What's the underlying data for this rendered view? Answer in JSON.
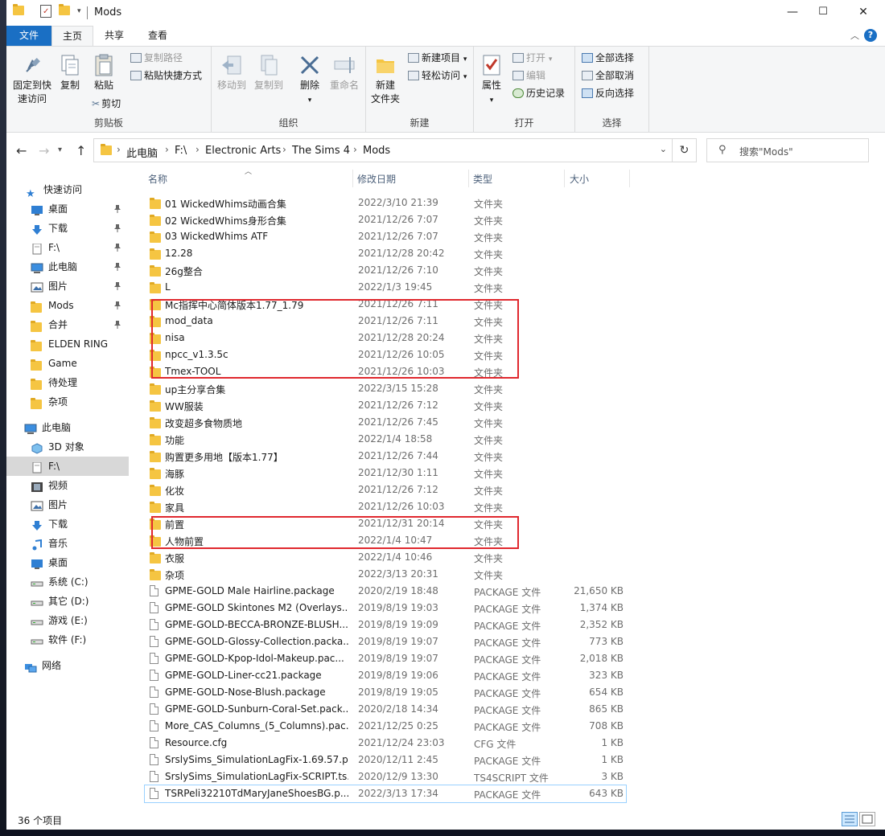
{
  "window": {
    "title": "Mods",
    "minimize": "—",
    "maximize": "☐",
    "close": "✕"
  },
  "tabs": {
    "file": "文件",
    "home": "主页",
    "share": "共享",
    "view": "查看"
  },
  "ribbon": {
    "clipboard": {
      "label": "剪贴板",
      "pin": "固定到快速访问",
      "pin_line1": "固定到快",
      "pin_line2": "速访问",
      "copy": "复制",
      "paste": "粘贴",
      "cut": "剪切",
      "copy_path": "复制路径",
      "paste_shortcut": "粘贴快捷方式"
    },
    "organize": {
      "label": "组织",
      "move_to": "移动到",
      "copy_to": "复制到",
      "delete": "删除",
      "rename": "重命名"
    },
    "new": {
      "label": "新建",
      "new_folder_line1": "新建",
      "new_folder_line2": "文件夹",
      "new_item": "新建项目",
      "easy_access": "轻松访问"
    },
    "open": {
      "label": "打开",
      "properties": "属性",
      "open": "打开",
      "edit": "编辑",
      "history": "历史记录"
    },
    "select": {
      "label": "选择",
      "select_all": "全部选择",
      "select_none": "全部取消",
      "invert": "反向选择"
    }
  },
  "address": {
    "crumbs": [
      "此电脑",
      "F:\\",
      "Electronic Arts",
      "The Sims 4",
      "Mods"
    ],
    "search_placeholder": "搜索\"Mods\""
  },
  "nav": {
    "quick_access": "快速访问",
    "quick_items": [
      {
        "label": "桌面",
        "icon": "desktop-icon",
        "pinned": true
      },
      {
        "label": "下载",
        "icon": "download-icon",
        "pinned": true
      },
      {
        "label": "F:\\",
        "icon": "drive-icon",
        "pinned": true
      },
      {
        "label": "此电脑",
        "icon": "computer-icon",
        "pinned": true
      },
      {
        "label": "图片",
        "icon": "pictures-icon",
        "pinned": true
      },
      {
        "label": "Mods",
        "icon": "folder-icon",
        "pinned": true
      },
      {
        "label": "合并",
        "icon": "folder-icon",
        "pinned": true
      },
      {
        "label": "ELDEN RING",
        "icon": "folder-icon",
        "pinned": false
      },
      {
        "label": "Game",
        "icon": "folder-icon",
        "pinned": false
      },
      {
        "label": "待处理",
        "icon": "folder-icon",
        "pinned": false
      },
      {
        "label": "杂项",
        "icon": "folder-icon",
        "pinned": false
      }
    ],
    "this_pc": "此电脑",
    "pc_items": [
      {
        "label": "3D 对象",
        "icon": "3d-objects-icon"
      },
      {
        "label": "F:\\",
        "icon": "drive-icon",
        "selected": true
      },
      {
        "label": "视频",
        "icon": "video-icon"
      },
      {
        "label": "图片",
        "icon": "pictures-icon"
      },
      {
        "label": "下载",
        "icon": "download-icon"
      },
      {
        "label": "音乐",
        "icon": "music-icon"
      },
      {
        "label": "桌面",
        "icon": "desktop-icon"
      },
      {
        "label": "系统 (C:)",
        "icon": "disk-icon"
      },
      {
        "label": "其它 (D:)",
        "icon": "disk-icon"
      },
      {
        "label": "游戏 (E:)",
        "icon": "disk-icon"
      },
      {
        "label": "软件 (F:)",
        "icon": "disk-icon"
      }
    ],
    "network": "网络"
  },
  "columns": {
    "name": "名称",
    "date": "修改日期",
    "type": "类型",
    "size": "大小"
  },
  "files": [
    {
      "name": "01 WickedWhims动画合集",
      "date": "2022/3/10 21:39",
      "type": "文件夹",
      "size": "",
      "kind": "folder"
    },
    {
      "name": "02 WickedWhims身形合集",
      "date": "2021/12/26 7:07",
      "type": "文件夹",
      "size": "",
      "kind": "folder"
    },
    {
      "name": "03 WickedWhims ATF",
      "date": "2021/12/26 7:07",
      "type": "文件夹",
      "size": "",
      "kind": "folder"
    },
    {
      "name": "12.28",
      "date": "2021/12/28 20:42",
      "type": "文件夹",
      "size": "",
      "kind": "folder"
    },
    {
      "name": "26g整合",
      "date": "2021/12/26 7:10",
      "type": "文件夹",
      "size": "",
      "kind": "folder"
    },
    {
      "name": "L",
      "date": "2022/1/3 19:45",
      "type": "文件夹",
      "size": "",
      "kind": "folder"
    },
    {
      "name": "Mc指挥中心简体版本1.77_1.79",
      "date": "2021/12/26 7:11",
      "type": "文件夹",
      "size": "",
      "kind": "folder"
    },
    {
      "name": "mod_data",
      "date": "2021/12/26 7:11",
      "type": "文件夹",
      "size": "",
      "kind": "folder"
    },
    {
      "name": "nisa",
      "date": "2021/12/28 20:24",
      "type": "文件夹",
      "size": "",
      "kind": "folder"
    },
    {
      "name": "npcc_v1.3.5c",
      "date": "2021/12/26 10:05",
      "type": "文件夹",
      "size": "",
      "kind": "folder"
    },
    {
      "name": "Tmex-TOOL",
      "date": "2021/12/26 10:03",
      "type": "文件夹",
      "size": "",
      "kind": "folder"
    },
    {
      "name": "up主分享合集",
      "date": "2022/3/15 15:28",
      "type": "文件夹",
      "size": "",
      "kind": "folder"
    },
    {
      "name": "WW服装",
      "date": "2021/12/26 7:12",
      "type": "文件夹",
      "size": "",
      "kind": "folder"
    },
    {
      "name": "改变超多食物质地",
      "date": "2021/12/26 7:45",
      "type": "文件夹",
      "size": "",
      "kind": "folder"
    },
    {
      "name": "功能",
      "date": "2022/1/4 18:58",
      "type": "文件夹",
      "size": "",
      "kind": "folder"
    },
    {
      "name": "购置更多用地【版本1.77】",
      "date": "2021/12/26 7:44",
      "type": "文件夹",
      "size": "",
      "kind": "folder"
    },
    {
      "name": "海豚",
      "date": "2021/12/30 1:11",
      "type": "文件夹",
      "size": "",
      "kind": "folder"
    },
    {
      "name": "化妆",
      "date": "2021/12/26 7:12",
      "type": "文件夹",
      "size": "",
      "kind": "folder"
    },
    {
      "name": "家具",
      "date": "2021/12/26 10:03",
      "type": "文件夹",
      "size": "",
      "kind": "folder"
    },
    {
      "name": "前置",
      "date": "2021/12/31 20:14",
      "type": "文件夹",
      "size": "",
      "kind": "folder"
    },
    {
      "name": "人物前置",
      "date": "2022/1/4 10:47",
      "type": "文件夹",
      "size": "",
      "kind": "folder"
    },
    {
      "name": "衣服",
      "date": "2022/1/4 10:46",
      "type": "文件夹",
      "size": "",
      "kind": "folder"
    },
    {
      "name": "杂项",
      "date": "2022/3/13 20:31",
      "type": "文件夹",
      "size": "",
      "kind": "folder"
    },
    {
      "name": "GPME-GOLD Male Hairline.package",
      "date": "2020/2/19 18:48",
      "type": "PACKAGE 文件",
      "size": "21,650 KB",
      "kind": "file"
    },
    {
      "name": "GPME-GOLD Skintones M2 (Overlays...",
      "date": "2019/8/19 19:03",
      "type": "PACKAGE 文件",
      "size": "1,374 KB",
      "kind": "file"
    },
    {
      "name": "GPME-GOLD-BECCA-BRONZE-BLUSH...",
      "date": "2019/8/19 19:09",
      "type": "PACKAGE 文件",
      "size": "2,352 KB",
      "kind": "file"
    },
    {
      "name": "GPME-GOLD-Glossy-Collection.packa...",
      "date": "2019/8/19 19:07",
      "type": "PACKAGE 文件",
      "size": "773 KB",
      "kind": "file"
    },
    {
      "name": "GPME-GOLD-Kpop-Idol-Makeup.pac...",
      "date": "2019/8/19 19:07",
      "type": "PACKAGE 文件",
      "size": "2,018 KB",
      "kind": "file"
    },
    {
      "name": "GPME-GOLD-Liner-cc21.package",
      "date": "2019/8/19 19:06",
      "type": "PACKAGE 文件",
      "size": "323 KB",
      "kind": "file"
    },
    {
      "name": "GPME-GOLD-Nose-Blush.package",
      "date": "2019/8/19 19:05",
      "type": "PACKAGE 文件",
      "size": "654 KB",
      "kind": "file"
    },
    {
      "name": "GPME-GOLD-Sunburn-Coral-Set.pack...",
      "date": "2020/2/18 14:34",
      "type": "PACKAGE 文件",
      "size": "865 KB",
      "kind": "file"
    },
    {
      "name": "More_CAS_Columns_(5_Columns).pac...",
      "date": "2021/12/25 0:25",
      "type": "PACKAGE 文件",
      "size": "708 KB",
      "kind": "file"
    },
    {
      "name": "Resource.cfg",
      "date": "2021/12/24 23:03",
      "type": "CFG 文件",
      "size": "1 KB",
      "kind": "file"
    },
    {
      "name": "SrslySims_SimulationLagFix-1.69.57.p...",
      "date": "2020/12/11 2:45",
      "type": "PACKAGE 文件",
      "size": "1 KB",
      "kind": "file"
    },
    {
      "name": "SrslySims_SimulationLagFix-SCRIPT.ts...",
      "date": "2020/12/9 13:30",
      "type": "TS4SCRIPT 文件",
      "size": "3 KB",
      "kind": "file"
    },
    {
      "name": "TSRPeli32210TdMaryJaneShoesBG.p...",
      "date": "2022/3/13 17:34",
      "type": "PACKAGE 文件",
      "size": "643 KB",
      "kind": "file",
      "focused": true
    }
  ],
  "status": {
    "item_count": "36 个项目"
  },
  "colors": {
    "accent": "#1a6fc4",
    "folder": "#f5c542",
    "highlight_box": "#e0282e"
  }
}
